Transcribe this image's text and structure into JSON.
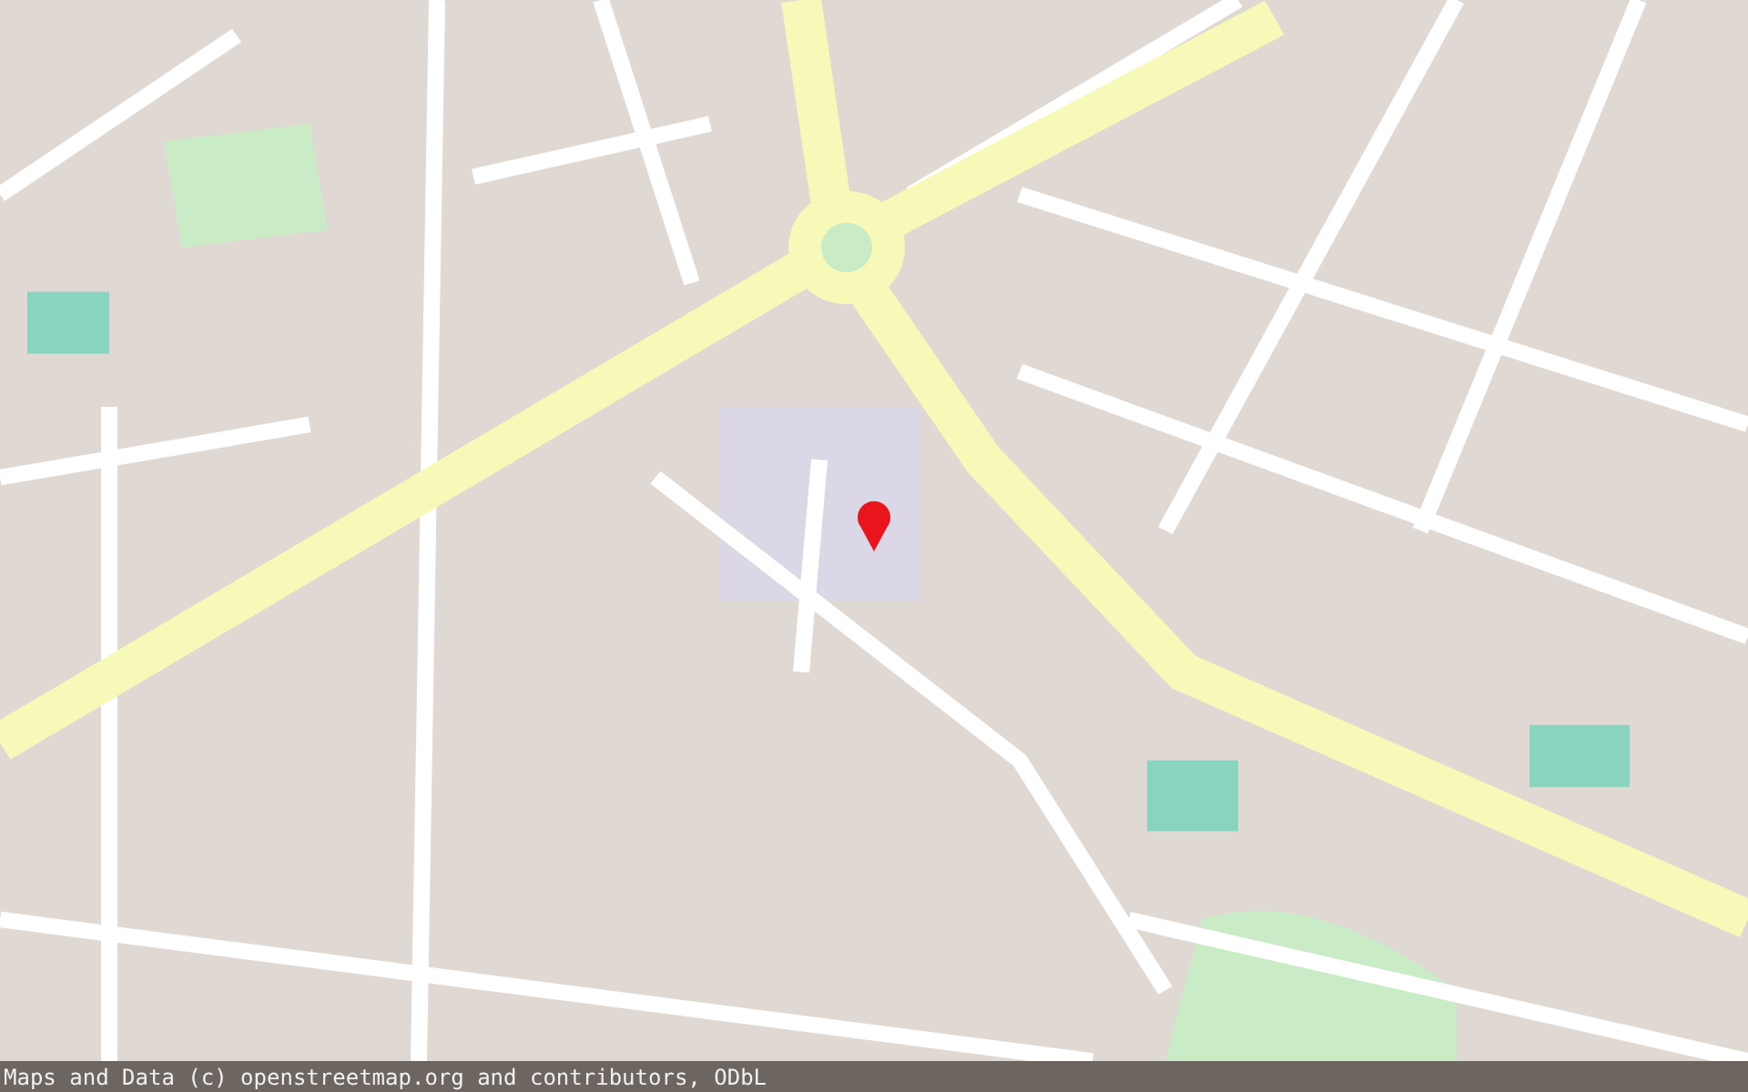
{
  "map": {
    "attribution": "Maps and Data (c) openstreetmap.org and contributors, ODbL"
  }
}
